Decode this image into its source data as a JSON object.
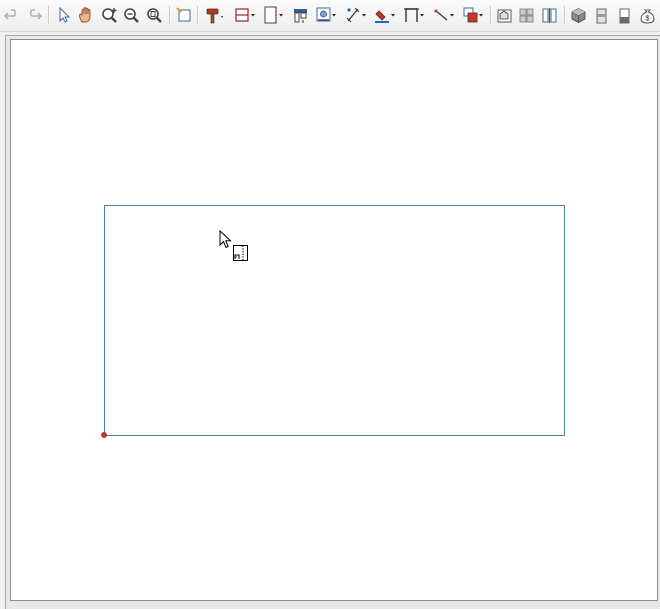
{
  "toolbar": {
    "tools": [
      {
        "name": "undo-button",
        "icon": "undo-icon",
        "enabled": false
      },
      {
        "name": "redo-button",
        "icon": "redo-icon",
        "enabled": false
      },
      {
        "name": "select-objects-button",
        "icon": "arrow-pointer-icon"
      },
      {
        "name": "pan-button",
        "icon": "hand-icon"
      },
      {
        "name": "zoom-in-button",
        "icon": "zoom-in-icon"
      },
      {
        "name": "zoom-out-button",
        "icon": "zoom-out-icon"
      },
      {
        "name": "fill-window-button",
        "icon": "zoom-fit-icon"
      },
      {
        "name": "plan-note-button",
        "icon": "note-icon"
      },
      {
        "name": "build-tools-button",
        "icon": "hammer-icon",
        "dropdown": true
      },
      {
        "name": "wall-tools-button",
        "icon": "wall-icon",
        "dropdown": true
      },
      {
        "name": "door-tools-button",
        "icon": "door-icon",
        "dropdown": true
      },
      {
        "name": "cabinet-tools-button",
        "icon": "cabinet-icon"
      },
      {
        "name": "library-button",
        "icon": "library-icon",
        "dropdown": true
      },
      {
        "name": "dimension-tools-button",
        "icon": "dimension-icon",
        "dropdown": true
      },
      {
        "name": "fill-tools-button",
        "icon": "paint-bucket-icon",
        "dropdown": true
      },
      {
        "name": "framing-tools-button",
        "icon": "framing-icon",
        "dropdown": true
      },
      {
        "name": "cad-line-tools-button",
        "icon": "line-icon",
        "dropdown": true
      },
      {
        "name": "layer-tools-button",
        "icon": "layers-icon",
        "dropdown": true
      },
      {
        "name": "material-list-button",
        "icon": "material-icon"
      },
      {
        "name": "grid-button",
        "icon": "grid-icon"
      },
      {
        "name": "elevation-button",
        "icon": "elevation-icon"
      },
      {
        "name": "3d-view-button",
        "icon": "cube-icon"
      },
      {
        "name": "cross-section-button",
        "icon": "section-icon"
      },
      {
        "name": "wall-elevation-button",
        "icon": "wall-elevation-icon"
      },
      {
        "name": "cost-estimator-button",
        "icon": "money-bag-icon"
      }
    ]
  },
  "colors": {
    "room_outline": "#4a7fae",
    "corner_marker": "#c0392b",
    "canvas_background": "#ffffff",
    "toolbar_background": "#f3f3f3"
  }
}
